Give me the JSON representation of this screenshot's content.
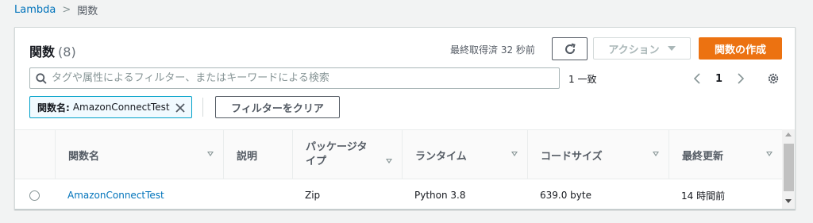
{
  "breadcrumb": {
    "root": "Lambda",
    "separator": ">",
    "current": "関数"
  },
  "panel": {
    "title": "関数",
    "count": "(8)",
    "last_fetched": "最終取得済 32 秒前",
    "actions_label": "アクション",
    "create_label": "関数の作成"
  },
  "search": {
    "placeholder": "タグや属性によるフィルター、またはキーワードによる検索",
    "value": "",
    "match_count": "1 一致"
  },
  "pagination": {
    "current_page": "1"
  },
  "filter": {
    "token_key": "関数名:",
    "token_value": "AmazonConnectTest",
    "clear_label": "フィルターをクリア"
  },
  "table": {
    "columns": [
      "関数名",
      "説明",
      "パッケージタイプ",
      "ランタイム",
      "コードサイズ",
      "最終更新"
    ],
    "rows": [
      {
        "name": "AmazonConnectTest",
        "description": "",
        "package_type": "Zip",
        "runtime": "Python 3.8",
        "code_size": "639.0 byte",
        "last_modified": "14 時間前"
      }
    ]
  },
  "colors": {
    "link": "#0073bb",
    "primary_button": "#ec7211",
    "token_border": "#00a1c9",
    "token_bg": "#f1faff"
  }
}
